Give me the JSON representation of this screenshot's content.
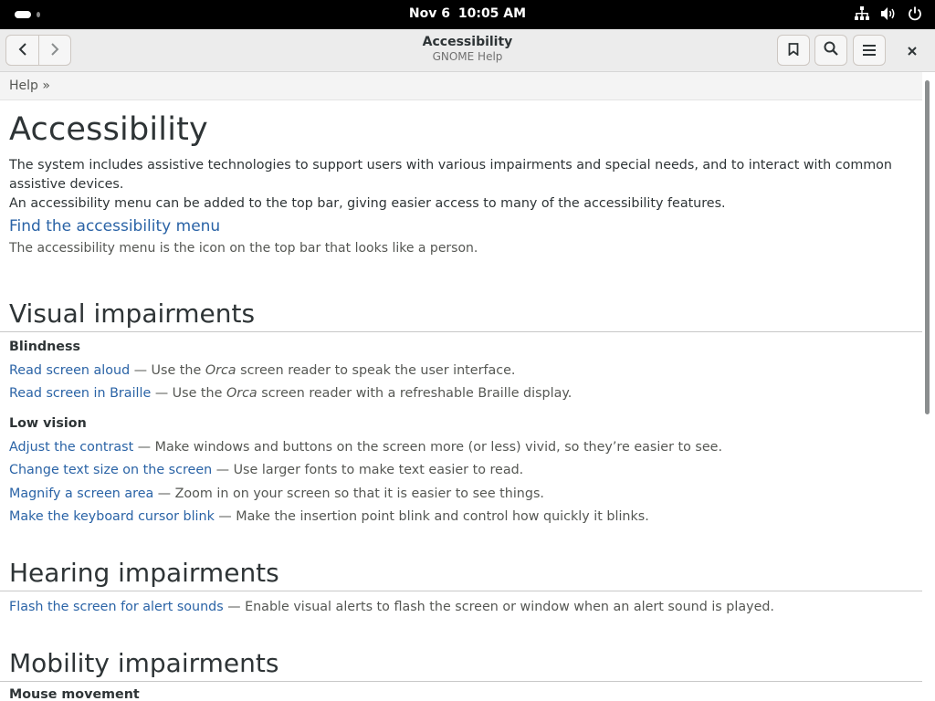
{
  "topbar": {
    "date": "Nov 6",
    "time": "10:05 AM"
  },
  "window": {
    "title": "Accessibility",
    "subtitle": "GNOME Help"
  },
  "breadcrumb": "Help »",
  "page": {
    "title": "Accessibility",
    "intro_line1": "The system includes assistive technologies to support users with various impairments and special needs, and to interact with common assistive devices.",
    "intro_line2": "An accessibility menu can be added to the top bar, giving easier access to many of the accessibility features.",
    "menu_link": "Find the accessibility menu",
    "menu_desc": "The accessibility menu is the icon on the top bar that looks like a person."
  },
  "visual": {
    "heading": "Visual impairments",
    "blindness": "Blindness",
    "items": [
      {
        "link": "Read screen aloud",
        "pre": " — Use the ",
        "em": "Orca",
        "post": " screen reader to speak the user interface."
      },
      {
        "link": "Read screen in Braille",
        "pre": " — Use the ",
        "em": "Orca",
        "post": " screen reader with a refreshable Braille display."
      }
    ],
    "low_vision": "Low vision",
    "low_items": [
      {
        "link": "Adjust the contrast",
        "desc": " — Make windows and buttons on the screen more (or less) vivid, so they’re easier to see."
      },
      {
        "link": "Change text size on the screen",
        "desc": " — Use larger fonts to make text easier to read."
      },
      {
        "link": "Magnify a screen area",
        "desc": " — Zoom in on your screen so that it is easier to see things."
      },
      {
        "link": "Make the keyboard cursor blink",
        "desc": " — Make the insertion point blink and control how quickly it blinks."
      }
    ]
  },
  "hearing": {
    "heading": "Hearing impairments",
    "items": [
      {
        "link": "Flash the screen for alert sounds",
        "desc": " — Enable visual alerts to flash the screen or window when an alert sound is played."
      }
    ]
  },
  "mobility": {
    "heading": "Mobility impairments",
    "subhead": "Mouse movement"
  },
  "icons": {
    "back": "go-back-icon",
    "forward": "go-forward-icon",
    "bookmark": "bookmark-icon",
    "search": "search-icon",
    "menu": "hamburger-menu-icon",
    "close": "close-icon",
    "network": "network-icon",
    "volume": "volume-icon",
    "power": "power-icon"
  },
  "colors": {
    "link": "#2a63a6",
    "topbar": "#000000",
    "headerbar": "#ececec"
  }
}
